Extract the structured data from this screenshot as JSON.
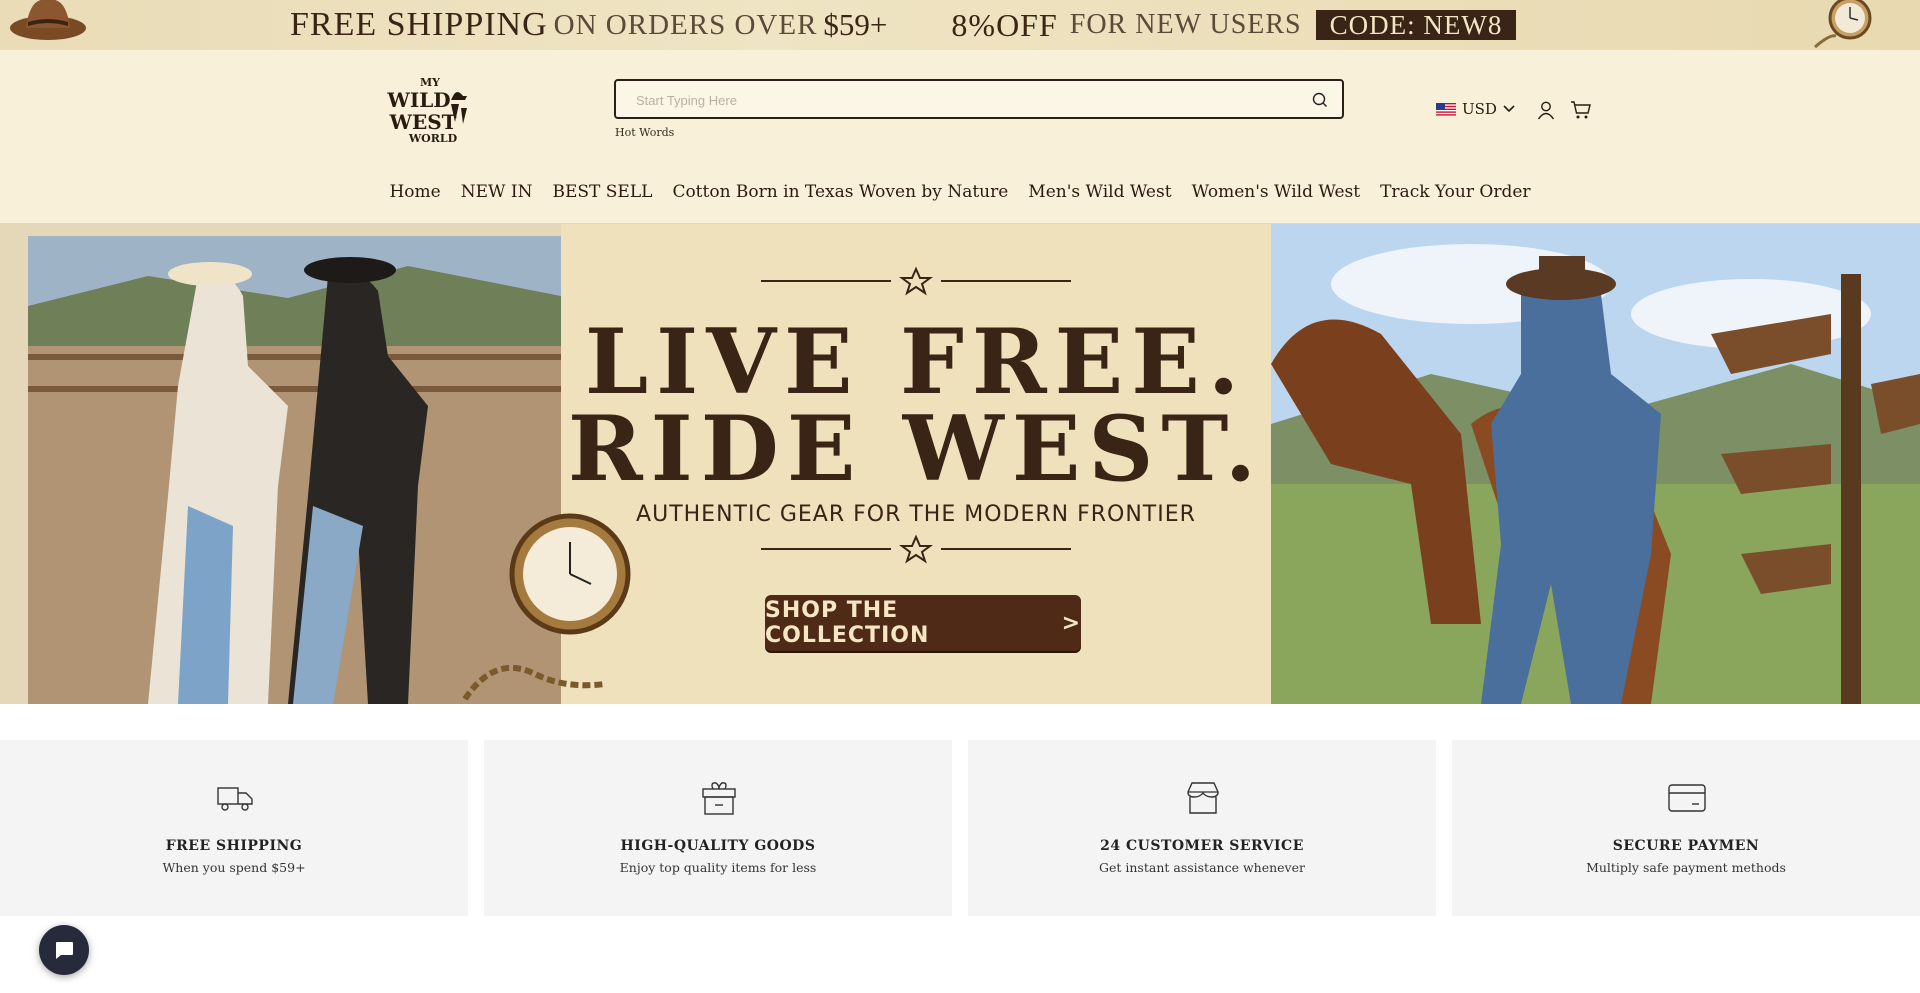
{
  "promo": {
    "free_shipping": "FREE SHIPPING",
    "on_orders_over": "ON ORDERS OVER",
    "amount": "$59+",
    "discount": "8%OFF",
    "for_new_users": "FOR NEW USERS",
    "code": "CODE: NEW8"
  },
  "header": {
    "logo_text": [
      "MY",
      "WILD",
      "WEST",
      "WORLD"
    ],
    "search_placeholder": "Start Typing Here",
    "hot_words": "Hot Words",
    "currency": "USD"
  },
  "nav": {
    "items": [
      "Home",
      "NEW IN",
      "BEST SELL",
      "Cotton Born in Texas Woven by Nature",
      "Men's Wild West",
      "Women's Wild West",
      "Track Your Order"
    ]
  },
  "hero": {
    "title_line1": "LIVE FREE.",
    "title_line2": "RIDE WEST.",
    "subtitle": "AUTHENTIC GEAR FOR THE MODERN FRONTIER",
    "cta": "SHOP THE COLLECTION",
    "cta_arrow": ">"
  },
  "features": [
    {
      "icon": "truck-icon",
      "title": "FREE SHIPPING",
      "desc": "When you spend $59+"
    },
    {
      "icon": "gift-box-icon",
      "title": "HIGH-QUALITY GOODS",
      "desc": "Enjoy top quality items for less"
    },
    {
      "icon": "store-icon",
      "title": "24 CUSTOMER SERVICE",
      "desc": "Get instant assistance whenever"
    },
    {
      "icon": "credit-card-icon",
      "title": "SECURE PAYMEN",
      "desc": "Multiply safe payment methods"
    }
  ],
  "colors": {
    "header_bg": "#f8f0d8",
    "brand_brown": "#3a2415",
    "cta_bg": "#4e2a17",
    "feature_bg": "#f4f4f4",
    "chat_bg": "#262a3a"
  }
}
